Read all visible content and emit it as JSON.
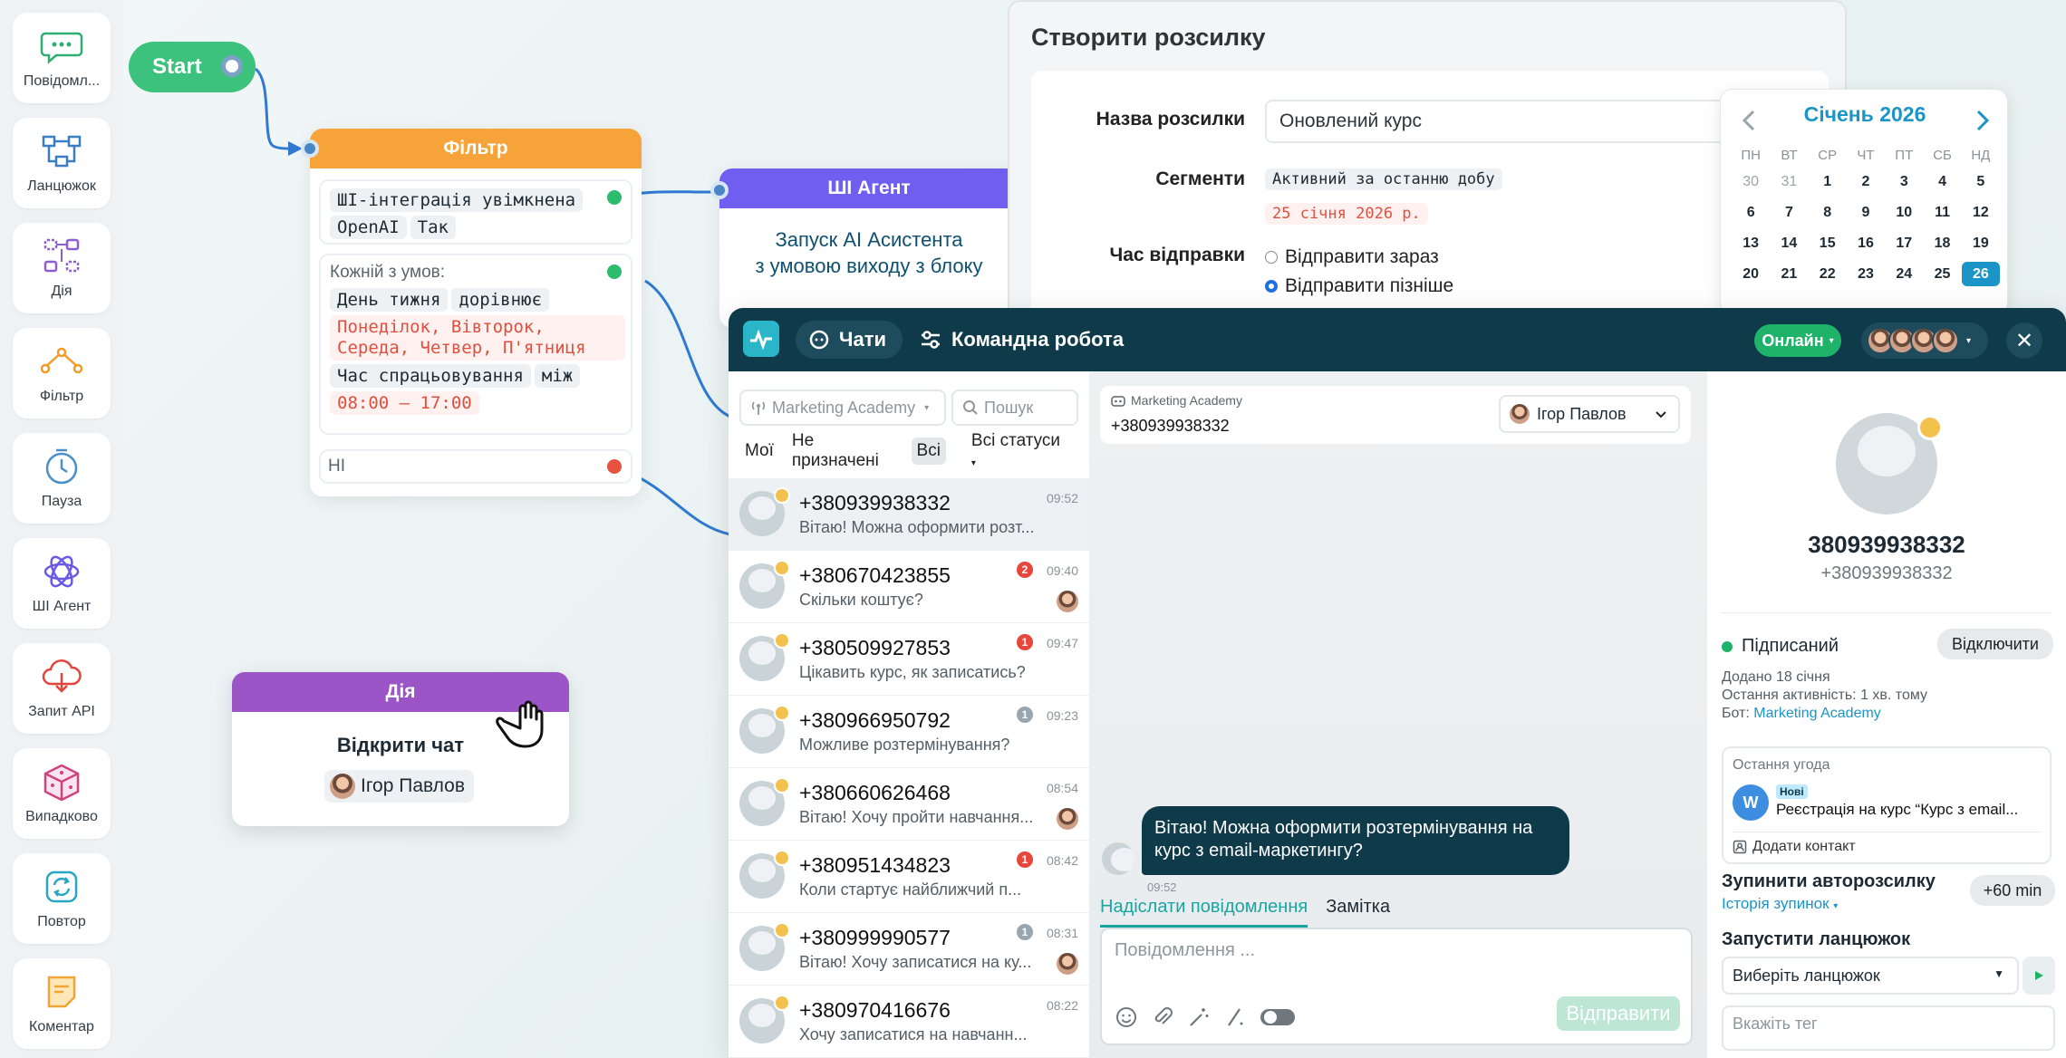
{
  "sidebar": {
    "items": [
      {
        "label": "Повідомл...",
        "icon": "message-bubble-icon"
      },
      {
        "label": "Ланцюжок",
        "icon": "chain-icon"
      },
      {
        "label": "Дія",
        "icon": "action-icon"
      },
      {
        "label": "Фільтр",
        "icon": "filter-icon"
      },
      {
        "label": "Пауза",
        "icon": "clock-icon"
      },
      {
        "label": "ШІ Агент",
        "icon": "ai-agent-icon"
      },
      {
        "label": "Запит API",
        "icon": "cloud-api-icon"
      },
      {
        "label": "Випадково",
        "icon": "dice-icon"
      },
      {
        "label": "Повтор",
        "icon": "repeat-icon"
      },
      {
        "label": "Коментар",
        "icon": "note-icon"
      }
    ]
  },
  "flow": {
    "start_label": "Start",
    "filter": {
      "title": "Фільтр",
      "cond1": [
        "ШІ-інтеграція увімкнена",
        "OpenAI",
        "Так"
      ],
      "cond2_title": "Кожній з умов:",
      "cond2_a": [
        "День тижня",
        "дорівнює"
      ],
      "cond2_days": "Понеділок, Вівторок, Середа, Четвер, П'ятниця",
      "cond2_b": [
        "Час спрацьовування",
        "між"
      ],
      "cond2_time": "08:00 — 17:00",
      "else_label": "НІ"
    },
    "agent": {
      "title": "ШІ Агент",
      "line1": "Запуск AI Асистента",
      "line2": "з умовою виходу з блоку"
    },
    "action": {
      "title": "Дія",
      "text": "Відкрити чат",
      "owner": "Ігор Павлов"
    }
  },
  "campaign": {
    "title": "Створити розсилку",
    "name_label": "Назва розсилки",
    "name_value": "Оновлений курс",
    "segments_label": "Сегменти",
    "segment_1": "Активний за останню добу",
    "segment_2": "25 січня 2026 р.",
    "send_time_label": "Час відправки",
    "send_now": "Відправити зараз",
    "send_later": "Відправити пізніше"
  },
  "calendar": {
    "month": "Січень 2026",
    "weekdays": [
      "ПН",
      "ВТ",
      "СР",
      "ЧТ",
      "ПТ",
      "СБ",
      "НД"
    ],
    "days": [
      "30",
      "31",
      "1",
      "2",
      "3",
      "4",
      "5",
      "6",
      "7",
      "8",
      "9",
      "10",
      "11",
      "12",
      "13",
      "14",
      "15",
      "16",
      "17",
      "18",
      "19",
      "20",
      "21",
      "22",
      "23",
      "24",
      "25",
      "26"
    ],
    "muted": [
      "30",
      "31"
    ],
    "selected": "26",
    "accent": "#1b95c7"
  },
  "chat": {
    "tab_chats": "Чати",
    "tab_team": "Командна робота",
    "status": "Онлайн",
    "account_select": "Marketing Academy",
    "search_placeholder": "Пошук",
    "filters": [
      "Мої",
      "Не призначені",
      "Всі",
      "Всі статуси"
    ],
    "active_filter": "Всі",
    "conversations": [
      {
        "phone": "+380939938332",
        "msg": "Вітаю! Можна оформити розт...",
        "time": "09:52",
        "count": "",
        "color": ""
      },
      {
        "phone": "+380670423855",
        "msg": "Скільки коштує?",
        "time": "09:40",
        "count": "2",
        "color": "red"
      },
      {
        "phone": "+380509927853",
        "msg": "Цікавить курс, як записатись?",
        "time": "09:47",
        "count": "1",
        "color": "red"
      },
      {
        "phone": "+380966950792",
        "msg": "Можливе розтермінування?",
        "time": "09:23",
        "count": "1",
        "color": "gray"
      },
      {
        "phone": "+380660626468",
        "msg": "Вітаю! Хочу пройти навчання...",
        "time": "08:54",
        "count": "",
        "color": ""
      },
      {
        "phone": "+380951434823",
        "msg": "Коли стартує найближчий п...",
        "time": "08:42",
        "count": "1",
        "color": "red"
      },
      {
        "phone": "+380999990577",
        "msg": "Вітаю! Хочу записатися на ку...",
        "time": "08:31",
        "count": "1",
        "color": "gray"
      },
      {
        "phone": "+380970416676",
        "msg": "Хочу записатися на навчанн...",
        "time": "08:22",
        "count": "",
        "color": ""
      }
    ],
    "current": {
      "account": "Marketing Academy",
      "phone": "+380939938332",
      "owner": "Ігор Павлов",
      "message": "Вітаю! Можна оформити розтермінування на курс з email-маркетингу?",
      "message_time": "09:52"
    },
    "compose_tab_send": "Надіслати повідомлення",
    "compose_tab_note": "Замітка",
    "compose_placeholder": "Повідомлення ...",
    "send_button": "Відправити"
  },
  "profile": {
    "name": "380939938332",
    "phone": "+380939938332",
    "status": "Підписаний",
    "unsubscribe": "Відключити",
    "added": "Додано 18 січня",
    "last_activity": "Остання активність: 1 хв. тому",
    "bot_label": "Бот:",
    "bot_name": "Marketing Academy",
    "last_deal_label": "Остання угода",
    "deal_badge": "Нові",
    "deal_title": "Реєстрація на курс “Курс з email...",
    "deal_avatar_letter": "W",
    "add_contact": "Додати контакт",
    "stop_campaign": "Зупинити авторозсилку",
    "stop_history": "Історія зупинок",
    "plus_time": "+60 min",
    "start_chain": "Запустити ланцюжок",
    "chain_select": "Виберіть ланцюжок",
    "tag_placeholder": "Вкажіть тег"
  }
}
